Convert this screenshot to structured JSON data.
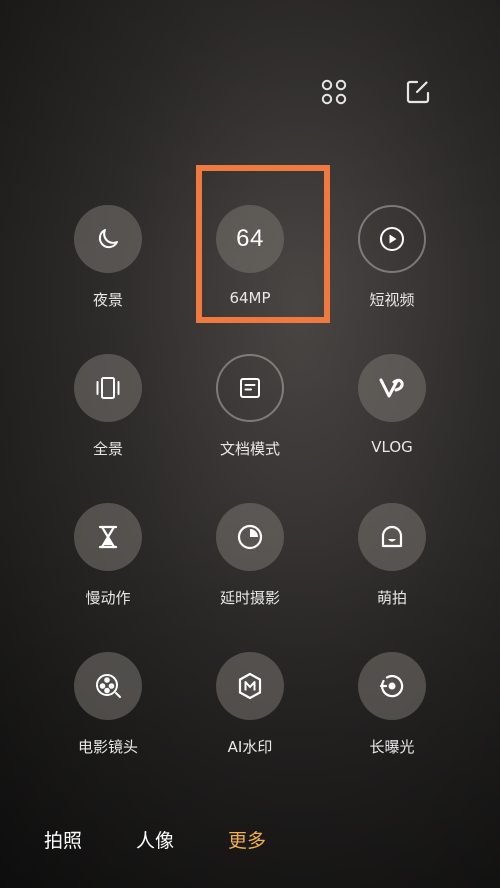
{
  "topbar": {
    "icons": [
      "grid-icon",
      "edit-icon"
    ]
  },
  "modes": [
    {
      "label": "夜景",
      "icon": "moon-icon"
    },
    {
      "label": "64MP",
      "icon": "64mp-icon",
      "badge": "64"
    },
    {
      "label": "短视频",
      "icon": "play-icon"
    },
    {
      "label": "全景",
      "icon": "panorama-icon"
    },
    {
      "label": "文档模式",
      "icon": "document-icon"
    },
    {
      "label": "VLOG",
      "icon": "vlog-icon"
    },
    {
      "label": "慢动作",
      "icon": "hourglass-icon"
    },
    {
      "label": "延时摄影",
      "icon": "timelapse-icon"
    },
    {
      "label": "萌拍",
      "icon": "cute-face-icon"
    },
    {
      "label": "电影镜头",
      "icon": "film-reel-icon"
    },
    {
      "label": "AI水印",
      "icon": "watermark-icon"
    },
    {
      "label": "长曝光",
      "icon": "long-exposure-icon"
    }
  ],
  "tabs": [
    {
      "label": "拍照"
    },
    {
      "label": "人像"
    },
    {
      "label": "更多",
      "active": true
    }
  ],
  "colors": {
    "highlight": "#f0793f",
    "active_tab": "#f2b04a"
  }
}
